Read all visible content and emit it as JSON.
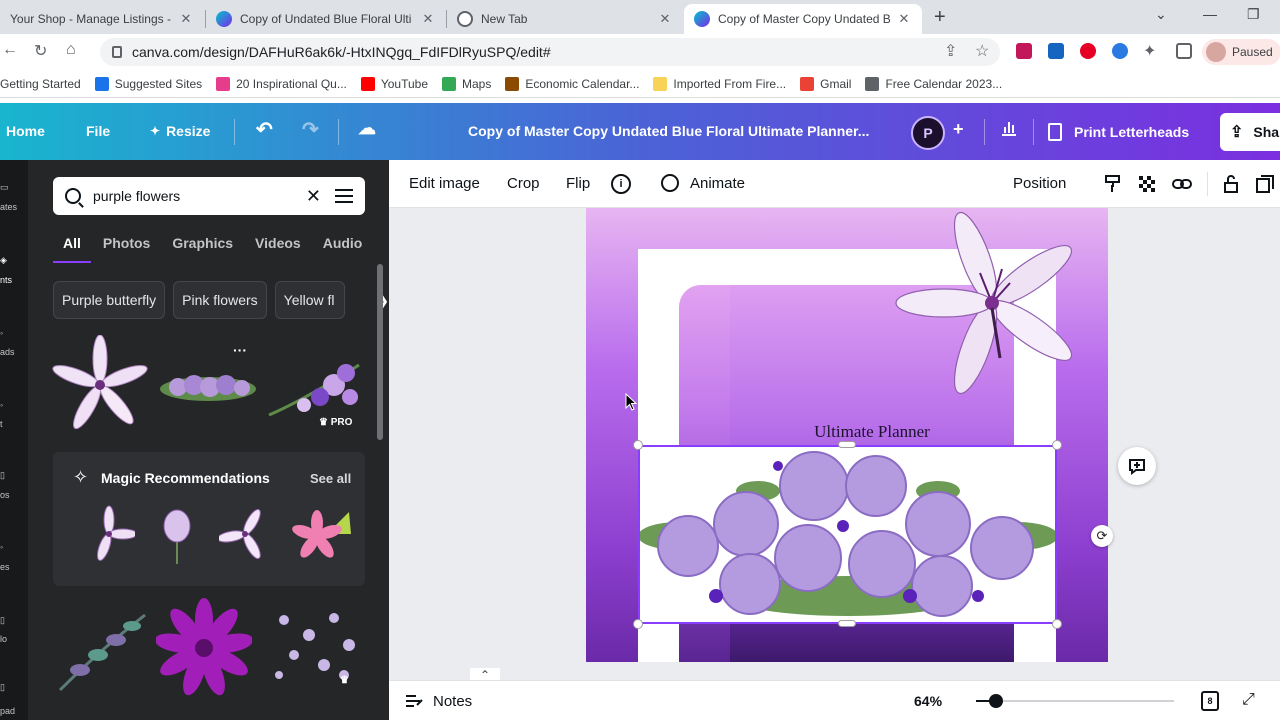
{
  "browser": {
    "tabs": [
      {
        "title": "Your Shop - Manage Listings - Et",
        "active": false
      },
      {
        "title": "Copy of Undated Blue Floral Ulti",
        "active": false
      },
      {
        "title": "New Tab",
        "active": false
      },
      {
        "title": "Copy of Master Copy Undated B",
        "active": true
      }
    ],
    "url": "canva.com/design/DAFHuR6ak6k/-HtxINQgq_FdIFDlRyuSPQ/edit#",
    "profile_status": "Paused",
    "bookmarks": [
      {
        "label": "Getting Started",
        "color": "#ffffff"
      },
      {
        "label": "Suggested Sites",
        "color": "#1a73e8"
      },
      {
        "label": "20 Inspirational Qu...",
        "color": "#e63d8a"
      },
      {
        "label": "YouTube",
        "color": "#ff0000"
      },
      {
        "label": "Maps",
        "color": "#34a853"
      },
      {
        "label": "Economic Calendar...",
        "color": "#8a4b00"
      },
      {
        "label": "Imported From Fire...",
        "color": "#f7d358"
      },
      {
        "label": "Gmail",
        "color": "#ea4335"
      },
      {
        "label": "Free Calendar 2023...",
        "color": "#5f6368"
      }
    ]
  },
  "canva_header": {
    "home": "Home",
    "file": "File",
    "resize": "Resize",
    "doc_title": "Copy of Master Copy Undated Blue Floral  Ultimate Planner...",
    "avatar_initials": "P",
    "print_button": "Print Letterheads",
    "share_button": "Sha"
  },
  "left_rail": {
    "labels": [
      "ates",
      "nts",
      "ads",
      "t",
      "os",
      "es",
      "lo",
      "pad"
    ]
  },
  "side_panel": {
    "search_query": "purple flowers",
    "tabs": [
      "All",
      "Photos",
      "Graphics",
      "Videos",
      "Audio"
    ],
    "active_tab": "All",
    "chips": [
      "Purple butterfly",
      "Pink flowers",
      "Yellow fl"
    ],
    "pro_badge": "PRO",
    "magic_title": "Magic Recommendations",
    "see_all": "See all"
  },
  "context_toolbar": {
    "edit_image": "Edit image",
    "crop": "Crop",
    "flip": "Flip",
    "info": "i",
    "animate": "Animate",
    "position": "Position"
  },
  "canvas": {
    "page_title": "Ultimate Planner"
  },
  "footer": {
    "notes": "Notes",
    "zoom": "64%",
    "zoom_fraction": 0.1,
    "page_count": "8"
  },
  "colors": {
    "header_start": "#19b5cf",
    "header_end": "#7b2fe0",
    "selection": "#8b3dff",
    "panel_bg": "#252627"
  }
}
